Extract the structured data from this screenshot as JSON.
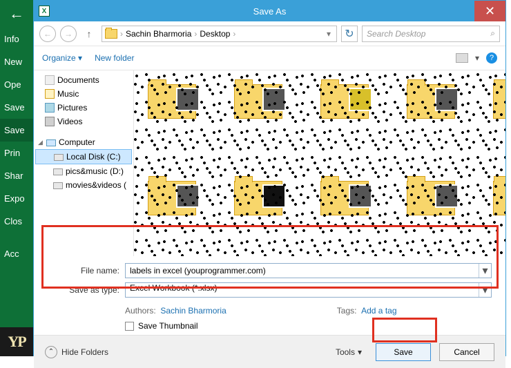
{
  "excel_sidebar": {
    "back_glyph": "←",
    "items": [
      "Info",
      "New",
      "Open",
      "Save",
      "Save As",
      "Print",
      "Share",
      "Export",
      "Close",
      "Account"
    ],
    "items_short": [
      "Info",
      "New",
      "Ope",
      "Save",
      "Save",
      "Prin",
      "Shar",
      "Expo",
      "Clos",
      "Acc"
    ],
    "selected_index": 4
  },
  "dialog": {
    "title": "Save As",
    "close_glyph": "✕",
    "nav": {
      "back_glyph": "←",
      "forward_glyph": "→",
      "up_glyph": "↑",
      "breadcrumb": [
        "Sachin Bharmoria",
        "Desktop"
      ],
      "dropdown_glyph": "▾",
      "refresh_glyph": "↻",
      "search_placeholder": "Search Desktop",
      "search_glyph": "⌕"
    },
    "toolbar": {
      "organize": "Organize",
      "organize_caret": "▾",
      "new_folder": "New folder",
      "view_caret": "▾",
      "help_glyph": "?"
    },
    "tree": {
      "libs": [
        "Documents",
        "Music",
        "Pictures",
        "Videos"
      ],
      "computer_label": "Computer",
      "drives": [
        "Local Disk (C:)",
        "pics&music (D:)",
        "movies&videos ("
      ],
      "selected_drive_index": 0
    },
    "form": {
      "filename_label": "File name:",
      "filename_value": "labels in excel (youprogrammer.com)",
      "type_label": "Save as type:",
      "type_value": "Excel Workbook (*.xlsx)",
      "authors_label": "Authors:",
      "authors_value": "Sachin Bharmoria",
      "tags_label": "Tags:",
      "tags_value": "Add a tag",
      "save_thumbnail": "Save Thumbnail"
    },
    "footer": {
      "hide_folders": "Hide Folders",
      "hide_caret": "⌃",
      "tools": "Tools",
      "tools_caret": "▾",
      "save": "Save",
      "cancel": "Cancel"
    }
  },
  "logo": "YP"
}
